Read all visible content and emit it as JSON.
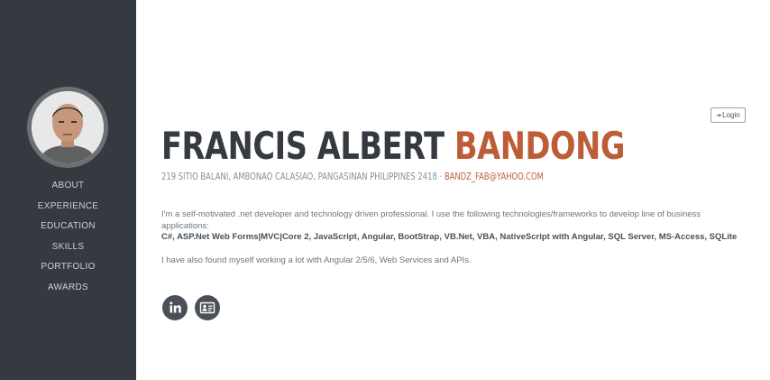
{
  "sidebar": {
    "nav": [
      "ABOUT",
      "EXPERIENCE",
      "EDUCATION",
      "SKILLS",
      "PORTFOLIO",
      "AWARDS"
    ]
  },
  "header": {
    "login_label": "Login",
    "login_icon": "sign-in-icon"
  },
  "profile": {
    "first_name": "FRANCIS ALBERT",
    "last_name": "BANDONG",
    "address": "219 SITIO BALANI, AMBONAO CALASIAO, PANGASINAN PHILIPPINES 2418 · ",
    "email": "BANDZ_FAB@YAHOO.COM",
    "intro": "I'm a self-motivated .net developer and technology driven professional. I use the following technologies/frameworks to develop line of business applications:",
    "technologies": "C#, ASP.Net Web Forms|MVC|Core 2, JavaScript, Angular, BootStrap, VB.Net, VBA, NativeScript with Angular, SQL Server, MS-Access, SQLite",
    "extra": "I have also found myself working a lot with Angular 2/5/6, Web Services and APIs."
  },
  "social": [
    "linkedin-icon",
    "id-card-icon"
  ],
  "colors": {
    "sidebar_bg": "#343a40",
    "accent": "#bd5d38",
    "heading": "#343a40",
    "muted": "#868e96"
  }
}
